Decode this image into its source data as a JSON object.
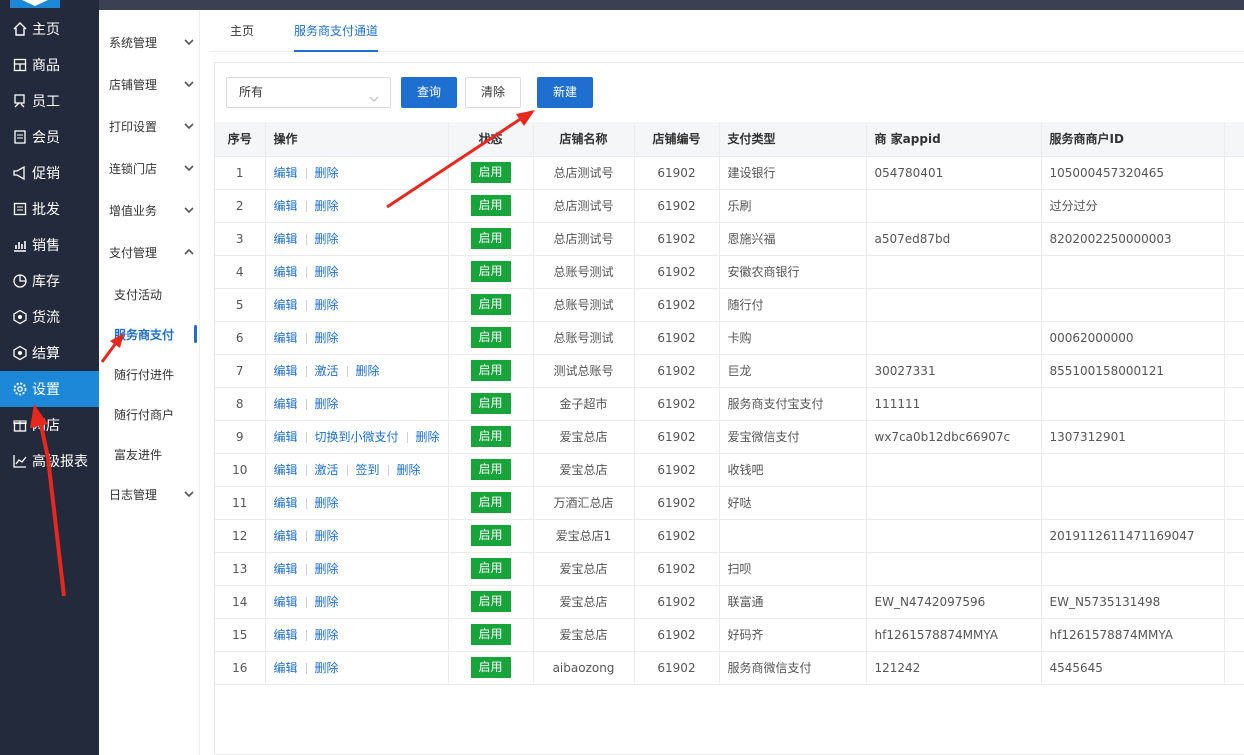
{
  "nav": [
    {
      "label": "主页",
      "icon": "home-icon"
    },
    {
      "label": "商品",
      "icon": "goods-icon"
    },
    {
      "label": "员工",
      "icon": "staff-icon"
    },
    {
      "label": "会员",
      "icon": "member-icon"
    },
    {
      "label": "促销",
      "icon": "promotion-icon"
    },
    {
      "label": "批发",
      "icon": "wholesale-icon"
    },
    {
      "label": "销售",
      "icon": "sales-chart-icon"
    },
    {
      "label": "库存",
      "icon": "inventory-icon"
    },
    {
      "label": "货流",
      "icon": "logistics-icon"
    },
    {
      "label": "结算",
      "icon": "settlement-icon"
    },
    {
      "label": "设置",
      "icon": "settings-gear-icon"
    },
    {
      "label": "网店",
      "icon": "gift-icon"
    },
    {
      "label": "高级报表",
      "icon": "report-chart-icon"
    }
  ],
  "subnav": {
    "groups": [
      "系统管理",
      "店铺管理",
      "打印设置",
      "连锁门店",
      "增值业务",
      "支付管理"
    ],
    "children": [
      "支付活动",
      "服务商支付",
      "随行付进件",
      "随行付商户",
      "富友进件"
    ],
    "last": "日志管理"
  },
  "tabs": [
    "主页",
    "服务商支付通道"
  ],
  "toolbar": {
    "select_value": "所有",
    "query": "查询",
    "clear": "清除",
    "create": "新建"
  },
  "table": {
    "headers": [
      "序号",
      "操作",
      "状态",
      "店铺名称",
      "店铺编号",
      "支付类型",
      "商 家appid",
      "服务商商户ID"
    ],
    "status_label": "启用",
    "rows": [
      {
        "no": "1",
        "ops": [
          "编辑",
          "删除"
        ],
        "store": "总店测试号",
        "code": "61902",
        "pay": "建设银行",
        "appid": "054780401",
        "mid": "105000457320465"
      },
      {
        "no": "2",
        "ops": [
          "编辑",
          "删除"
        ],
        "store": "总店测试号",
        "code": "61902",
        "pay": "乐刷",
        "appid": "",
        "mid": "过分过分"
      },
      {
        "no": "3",
        "ops": [
          "编辑",
          "删除"
        ],
        "store": "总店测试号",
        "code": "61902",
        "pay": "恩施兴福",
        "appid": "a507ed87bd",
        "mid": "8202002250000003"
      },
      {
        "no": "4",
        "ops": [
          "编辑",
          "删除"
        ],
        "store": "总账号测试",
        "code": "61902",
        "pay": "安徽农商银行",
        "appid": "",
        "mid": ""
      },
      {
        "no": "5",
        "ops": [
          "编辑",
          "删除"
        ],
        "store": "总账号测试",
        "code": "61902",
        "pay": "随行付",
        "appid": "",
        "mid": ""
      },
      {
        "no": "6",
        "ops": [
          "编辑",
          "删除"
        ],
        "store": "总账号测试",
        "code": "61902",
        "pay": "卡购",
        "appid": "",
        "mid": "00062000000"
      },
      {
        "no": "7",
        "ops": [
          "编辑",
          "激活",
          "删除"
        ],
        "store": "测试总账号",
        "code": "61902",
        "pay": "巨龙",
        "appid": "30027331",
        "mid": "855100158000121"
      },
      {
        "no": "8",
        "ops": [
          "编辑",
          "删除"
        ],
        "store": "金子超市",
        "code": "61902",
        "pay": "服务商支付宝支付",
        "appid": "111111",
        "mid": ""
      },
      {
        "no": "9",
        "ops": [
          "编辑",
          "切换到小微支付",
          "删除"
        ],
        "store": "爱宝总店",
        "code": "61902",
        "pay": "爱宝微信支付",
        "appid": "wx7ca0b12dbc66907c",
        "mid": "1307312901"
      },
      {
        "no": "10",
        "ops": [
          "编辑",
          "激活",
          "签到",
          "删除"
        ],
        "store": "爱宝总店",
        "code": "61902",
        "pay": "收钱吧",
        "appid": "",
        "mid": ""
      },
      {
        "no": "11",
        "ops": [
          "编辑",
          "删除"
        ],
        "store": "万酒汇总店",
        "code": "61902",
        "pay": "好哒",
        "appid": "",
        "mid": ""
      },
      {
        "no": "12",
        "ops": [
          "编辑",
          "删除"
        ],
        "store": "爱宝总店1",
        "code": "61902",
        "pay": "",
        "appid": "",
        "mid": "2019112611471169047"
      },
      {
        "no": "13",
        "ops": [
          "编辑",
          "删除"
        ],
        "store": "爱宝总店",
        "code": "61902",
        "pay": "扫呗",
        "appid": "",
        "mid": ""
      },
      {
        "no": "14",
        "ops": [
          "编辑",
          "删除"
        ],
        "store": "爱宝总店",
        "code": "61902",
        "pay": "联富通",
        "appid": "EW_N4742097596",
        "mid": "EW_N5735131498"
      },
      {
        "no": "15",
        "ops": [
          "编辑",
          "删除"
        ],
        "store": "爱宝总店",
        "code": "61902",
        "pay": "好码齐",
        "appid": "hf1261578874MMYA",
        "mid": "hf1261578874MMYA"
      },
      {
        "no": "16",
        "ops": [
          "编辑",
          "删除"
        ],
        "store": "aibaozong",
        "code": "61902",
        "pay": "服务商微信支付",
        "appid": "121242",
        "mid": "4545645"
      }
    ]
  },
  "colors": {
    "nav_bg": "#232a3b",
    "accent": "#1e6fd0",
    "active_nav": "#1e88d8",
    "status_green": "#17a43b",
    "annotation_red": "#e8281e"
  }
}
